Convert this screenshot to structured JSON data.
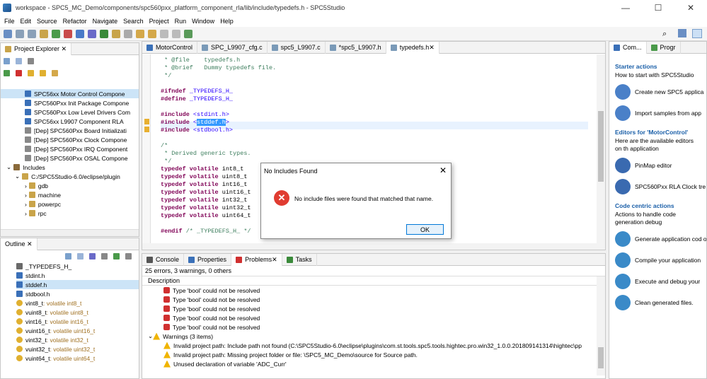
{
  "window": {
    "title": "workspace - SPC5_MC_Demo/components/spc560pxx_platform_component_rla/lib/include/typedefs.h - SPC5Studio"
  },
  "menu": [
    "File",
    "Edit",
    "Source",
    "Refactor",
    "Navigate",
    "Search",
    "Project",
    "Run",
    "Window",
    "Help"
  ],
  "project_explorer": {
    "tab": "Project Explorer",
    "items": [
      "SPC56xx Motor Control Compone",
      "SPC560Pxx Init Package Compone",
      "SPC560Pxx Low Level Drivers Com",
      "SPC56xx L9907 Component RLA",
      "[Dep] SPC560Pxx Board Initializati",
      "[Dep] SPC560Pxx Clock Compone",
      "[Dep] SPC560Pxx IRQ Component",
      "[Dep] SPC560Pxx OSAL Compone",
      "Includes",
      "C:/SPC5Studio-6.0/eclipse/plugin",
      "gdb",
      "machine",
      "powerpc",
      "rpc"
    ]
  },
  "outline": {
    "tab": "Outline",
    "items": [
      {
        "name": "_TYPEDEFS_H_",
        "type": ""
      },
      {
        "name": "stdint.h",
        "type": ""
      },
      {
        "name": "stddef.h",
        "type": ""
      },
      {
        "name": "stdbool.h",
        "type": ""
      },
      {
        "name": "vint8_t",
        "type": " : volatile int8_t"
      },
      {
        "name": "vuint8_t",
        "type": " : volatile uint8_t"
      },
      {
        "name": "vint16_t",
        "type": " : volatile int16_t"
      },
      {
        "name": "vuint16_t",
        "type": " : volatile uint16_t"
      },
      {
        "name": "vint32_t",
        "type": " : volatile int32_t"
      },
      {
        "name": "vuint32_t",
        "type": " : volatile uint32_t"
      },
      {
        "name": "vuint64_t",
        "type": " : volatile uint64_t"
      }
    ]
  },
  "editor": {
    "tabs": [
      "MotorControl",
      "SPC_L9907_cfg.c",
      "spc5_L9907.c",
      "*spc5_L9907.h",
      "typedefs.h"
    ],
    "lines": [
      " * @file    typedefs.h",
      " * @brief   Dummy typedefs file.",
      " */",
      "",
      "#ifndef _TYPEDEFS_H_",
      "#define _TYPEDEFS_H_",
      "",
      "#include <stdint.h>",
      "#include <stddef.h>",
      "#include <stdbool.h>",
      "",
      "/*",
      " * Derived generic types.",
      " */",
      "typedef volatile int8_t",
      "typedef volatile uint8_t",
      "typedef volatile int16_t",
      "typedef volatile uint16_t",
      "typedef volatile int32_t",
      "typedef volatile uint32_t",
      "typedef volatile uint64_t",
      "",
      "#endif /* _TYPEDEFS_H_ */"
    ]
  },
  "dialog": {
    "title": "No Includes Found",
    "message": "No include files were found that matched that name.",
    "ok": "OK"
  },
  "problems": {
    "tabs": [
      "Console",
      "Properties",
      "Problems",
      "Tasks"
    ],
    "summary": "25 errors, 3 warnings, 0 others",
    "header": "Description",
    "errors": [
      "Type 'bool' could not be resolved",
      "Type 'bool' could not be resolved",
      "Type 'bool' could not be resolved",
      "Type 'bool' could not be resolved",
      "Type 'bool' could not be resolved"
    ],
    "warnings_label": "Warnings (3 items)",
    "warnings": [
      "Invalid project path: Include path not found (C:\\SPC5Studio-6.0\\eclipse\\plugins\\com.st.tools.spc5.tools.hightec.pro.win32_1.0.0.201809141314\\hightec\\pp",
      "Invalid project path: Missing project folder or file: \\SPC5_MC_Demo\\source for Source path.",
      "Unused declaration of variable 'ADC_Curr'"
    ]
  },
  "right_panel": {
    "tabs": [
      "Com...",
      "Progr"
    ],
    "starter_title": "Starter actions",
    "starter_desc": "How to start with SPC5Studio",
    "starter_items": [
      "Create new SPC5 applica",
      "Import samples from app"
    ],
    "editors_title": "Editors for 'MotorControl'",
    "editors_desc": "Here are the available editors on th application",
    "editor_items": [
      "PinMap editor",
      "SPC560Pxx RLA Clock tre"
    ],
    "code_title": "Code centric actions",
    "code_desc": "Actions to handle code generation debug",
    "code_items": [
      "Generate application cod overwriting all previous c",
      "Compile your application",
      "Execute and debug your",
      "Clean generated files."
    ]
  }
}
